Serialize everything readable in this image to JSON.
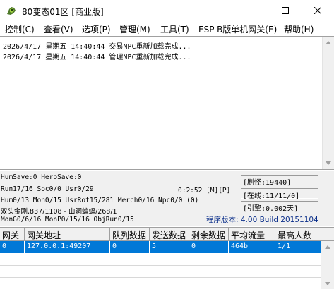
{
  "window": {
    "title": "80变态01区 [商业版]"
  },
  "menu": [
    "控制(C)",
    "查看(V)",
    "选项(P)",
    "管理(M)",
    "工具(T)",
    "ESP-B版单机网关(E)",
    "帮助(H)"
  ],
  "log": [
    "2026/4/17 星期五 14:40:44 交易NPC重新加载完成...",
    "2026/4/17 星期五 14:40:44 管理NPC重新加载完成..."
  ],
  "status": {
    "hum_save": "HumSave:0 HeroSave:0",
    "run": "Run17/16 Soc0/0 Usr0/29",
    "time_mp": "0:2:52 [M][P]",
    "hum": "Hum0/13 Mon0/15 UsrRot15/281 Merch0/16 Npc0/0 (0)",
    "map_line": "双头金刚,837/1108 - 山洞蝙蝠/268/1",
    "mon_line": "MonG0/6/16 MonP0/15/16 ObjRun0/15",
    "refresh": "[刷怪:19440]",
    "online": "[在线:11/11/0]",
    "engine": "[引擎:0.002天]",
    "version": "程序版本: 4.00 Build 20151104"
  },
  "table": {
    "columns": [
      "网关",
      "网关地址",
      "队列数据",
      "发送数据",
      "剩余数据",
      "平均流量",
      "最高人数"
    ],
    "rows": [
      [
        "0",
        "127.0.0.1:49207",
        "0",
        "5",
        "0",
        "464b",
        "1/1"
      ]
    ]
  },
  "colors": {
    "selection": "#0078d7",
    "version_text": "#0b2f8a"
  }
}
